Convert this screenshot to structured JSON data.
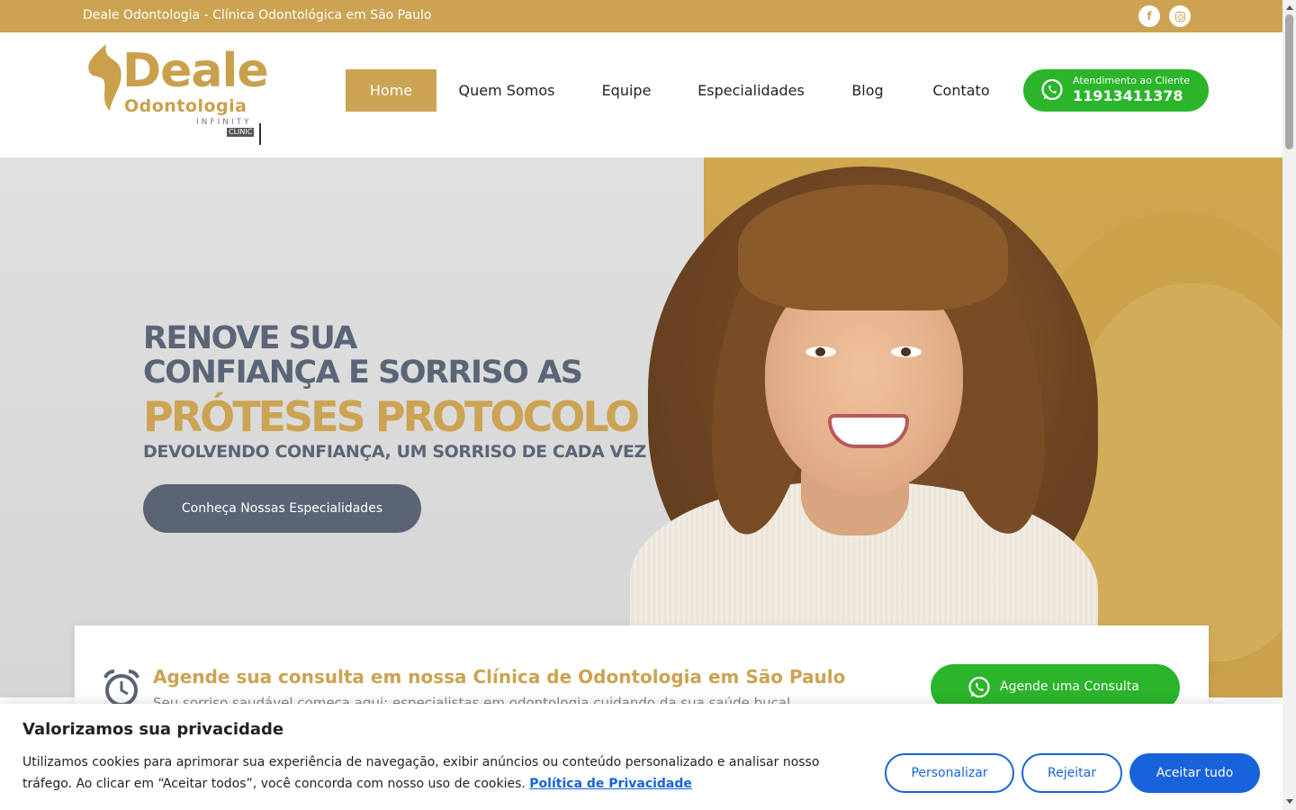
{
  "topbar": {
    "text": "Deale Odontologia - Clínica Odontológica em São Paulo",
    "facebook_icon": "facebook-icon",
    "instagram_icon": "instagram-icon",
    "facebook_glyph": "f"
  },
  "logo": {
    "word": "Deale",
    "sub": "Odontologia",
    "infinity": "INFINITY",
    "clinic": "CLINIC"
  },
  "nav": {
    "items": [
      {
        "label": "Home",
        "active": true
      },
      {
        "label": "Quem Somos"
      },
      {
        "label": "Equipe"
      },
      {
        "label": "Especialidades"
      },
      {
        "label": "Blog"
      },
      {
        "label": "Contato"
      }
    ]
  },
  "whatsapp_header": {
    "small": "Atendimento ao Cliente",
    "number": "11913411378"
  },
  "hero": {
    "line1": "RENOVE SUA",
    "line2": "CONFIANÇA E SORRISO AS",
    "highlight": "PRÓTESES PROTOCOLO",
    "tagline": "DEVOLVENDO CONFIANÇA, UM SORRISO DE CADA VEZ",
    "button": "Conheça Nossas Especialidades"
  },
  "booking": {
    "title": "Agende sua consulta em nossa Clínica de Odontologia em São Paulo",
    "subtitle": "Seu sorriso saudável começa aqui: especialistas em odontologia cuidando da sua saúde bucal.",
    "button": "Agende uma Consulta"
  },
  "cookie": {
    "title": "Valorizamos sua privacidade",
    "text1": "Utilizamos cookies para aprimorar sua experiência de navegação, exibir anúncios ou conteúdo personalizado e analisar nosso",
    "text2": "tráfego. Ao clicar em “Aceitar todos”, você concorda com nosso uso de cookies.",
    "link": "Política de Privacidade",
    "customize": "Personalizar",
    "reject": "Rejeitar",
    "accept": "Aceitar tudo"
  },
  "colors": {
    "gold": "#cba352",
    "slate": "#5b6475",
    "whatsapp_green": "#2bb52b",
    "cookie_blue": "#1863dc"
  }
}
